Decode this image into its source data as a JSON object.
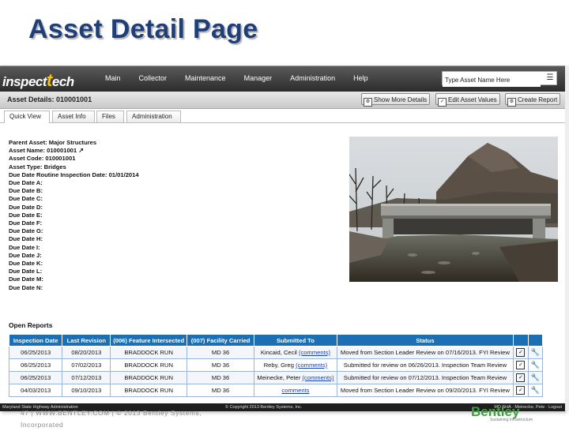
{
  "slide": {
    "title": "Asset Detail Page",
    "footer_line1": "47 | WWW.BENTLEY.COM | © 2013 Bentley Systems,",
    "footer_line2": "Incorporated",
    "brand": "Bentley",
    "brand_tagline": "Sustaining Infrastructure"
  },
  "app": {
    "logo_prefix": "inspect",
    "logo_t": "t",
    "logo_suffix": "ech",
    "nav": [
      "Main",
      "Collector",
      "Maintenance",
      "Manager",
      "Administration",
      "Help"
    ],
    "search": {
      "value": "Type Asset Name Here"
    },
    "header": {
      "title": "Asset Details: 010001001",
      "buttons": [
        "Show More Details",
        "Edit Asset Values",
        "Create Report"
      ]
    },
    "tabs": [
      "Quick View",
      "Asset Info",
      "Files",
      "Administration"
    ],
    "details": {
      "parent_asset": "Parent Asset: Major Structures",
      "asset_name": "Asset Name: 010001001",
      "asset_code": "Asset Code: 010001001",
      "asset_type": "Asset Type: Bridges",
      "routine_due": "Due Date Routine Inspection Date: 01/01/2014",
      "due_dates": [
        "Due Date A:",
        "Due Date B:",
        "Due Date C:",
        "Due Date D:",
        "Due Date E:",
        "Due Date F:",
        "Due Date G:",
        "Due Date H:",
        "Due Date I:",
        "Due Date J:",
        "Due Date K:",
        "Due Date L:",
        "Due Date M:",
        "Due Date N:"
      ]
    },
    "open_reports": {
      "label": "Open Reports",
      "columns": [
        "Inspection Date",
        "Last Revision",
        "(006) Feature Intersected",
        "(007) Facility Carried",
        "Submitted To",
        "Status"
      ],
      "rows": [
        {
          "inspection_date": "06/25/2013",
          "last_revision": "08/20/2013",
          "feature": "BRADDOCK RUN",
          "facility": "MD 36",
          "submitted_name": "Kincaid, Cecil",
          "submitted_link": "(comments)",
          "status": "Moved from Section Leader Review on 07/16/2013. FYI Review"
        },
        {
          "inspection_date": "06/25/2013",
          "last_revision": "07/02/2013",
          "feature": "BRADDOCK RUN",
          "facility": "MD 36",
          "submitted_name": "Reby, Greg",
          "submitted_link": "(comments)",
          "status": "Submitted for review on 06/26/2013. Inspection Team Review"
        },
        {
          "inspection_date": "06/25/2013",
          "last_revision": "07/12/2013",
          "feature": "BRADDOCK RUN",
          "facility": "MD 36",
          "submitted_name": "Meinecke, Peter",
          "submitted_link": "(comments)",
          "status": "Submitted for review on 07/12/2013. Inspection Team Review"
        },
        {
          "inspection_date": "04/03/2013",
          "last_revision": "09/10/2013",
          "feature": "BRADDOCK RUN",
          "facility": "MD 36",
          "submitted_name": "",
          "submitted_link": "comments",
          "status": "Moved from Section Leader Review on 09/20/2013. FYI Review"
        }
      ]
    },
    "footer": {
      "left": "Maryland State Highway Administration",
      "center": "© Copyright 2013 Bentley Systems, Inc.",
      "right": "MD SHA · Meinecke, Pete · Logout"
    }
  }
}
